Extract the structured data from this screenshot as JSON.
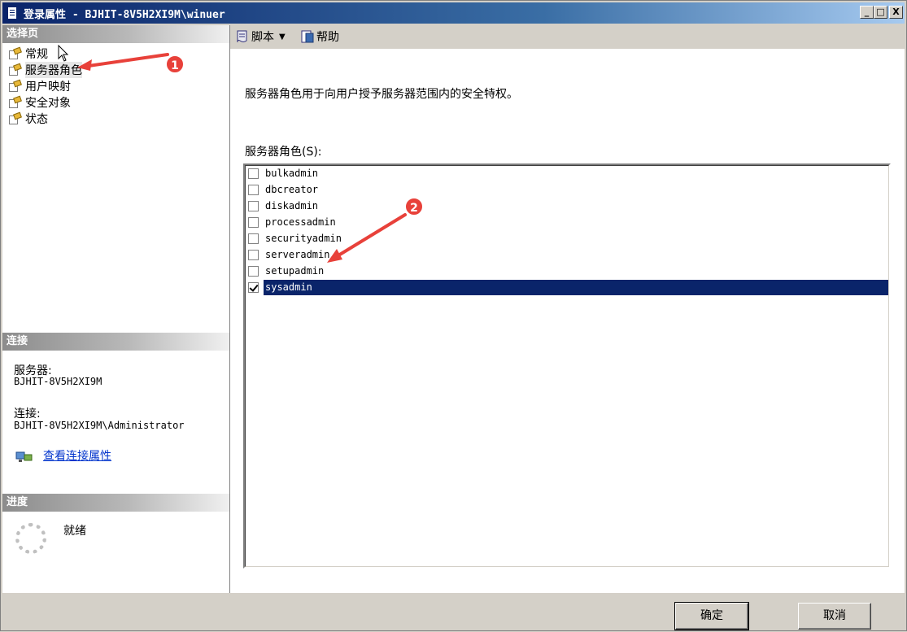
{
  "window": {
    "title": "登录属性 - BJHIT-8V5H2XI9M\\winuer",
    "min_label": "_",
    "max_label": "□",
    "close_label": "X"
  },
  "left_panel": {
    "select_page_header": "选择页",
    "pages": [
      {
        "label": "常规",
        "selected": false
      },
      {
        "label": "服务器角色",
        "selected": true
      },
      {
        "label": "用户映射",
        "selected": false
      },
      {
        "label": "安全对象",
        "selected": false
      },
      {
        "label": "状态",
        "selected": false
      }
    ],
    "connection_header": "连接",
    "server_label": "服务器:",
    "server_value": "BJHIT-8V5H2XI9M",
    "connection_label": "连接:",
    "connection_value": "BJHIT-8V5H2XI9M\\Administrator",
    "view_connection_link": "查看连接属性",
    "progress_header": "进度",
    "progress_status": "就绪"
  },
  "toolbar": {
    "script_label": "脚本",
    "help_label": "帮助"
  },
  "main": {
    "description": "服务器角色用于向用户授予服务器范围内的安全特权。",
    "roles_label": "服务器角色(S):",
    "roles": [
      {
        "name": "bulkadmin",
        "checked": false
      },
      {
        "name": "dbcreator",
        "checked": false
      },
      {
        "name": "diskadmin",
        "checked": false
      },
      {
        "name": "processadmin",
        "checked": false
      },
      {
        "name": "securityadmin",
        "checked": false
      },
      {
        "name": "serveradmin",
        "checked": false
      },
      {
        "name": "setupadmin",
        "checked": false
      },
      {
        "name": "sysadmin",
        "checked": true
      }
    ]
  },
  "buttons": {
    "ok_label": "确定",
    "cancel_label": "取消"
  },
  "annotations": {
    "badge1": "1",
    "badge2": "2",
    "color": "#e8413a"
  }
}
